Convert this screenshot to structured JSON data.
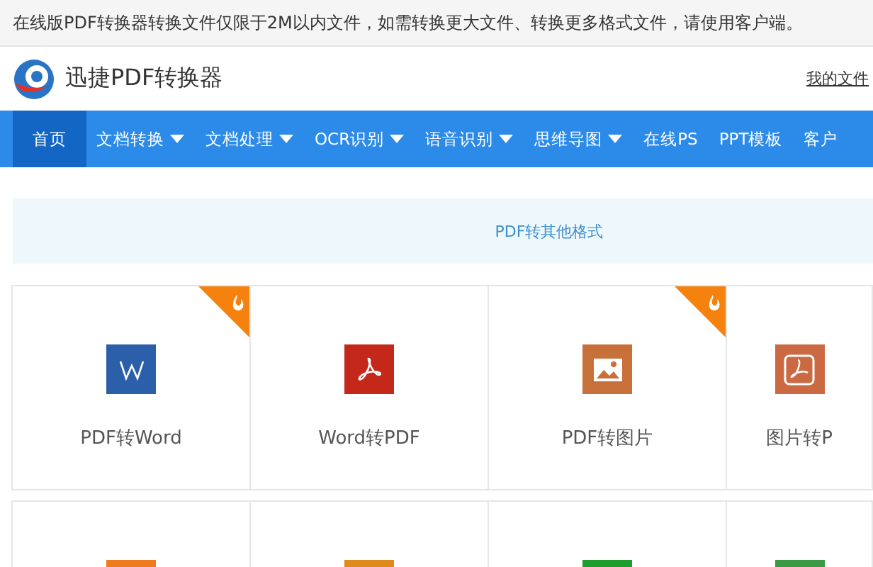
{
  "notice": "在线版PDF转换器转换文件仅限于2M以内文件，如需转换更大文件、转换更多格式文件，请使用客户端。",
  "header": {
    "title": "迅捷PDF转换器",
    "link": "我的文件"
  },
  "nav": [
    {
      "label": "首页",
      "selected": true,
      "dropdown": false
    },
    {
      "label": "文档转换",
      "selected": false,
      "dropdown": true
    },
    {
      "label": "文档处理",
      "selected": false,
      "dropdown": true
    },
    {
      "label": "OCR识别",
      "selected": false,
      "dropdown": true
    },
    {
      "label": "语音识别",
      "selected": false,
      "dropdown": true
    },
    {
      "label": "思维导图",
      "selected": false,
      "dropdown": true
    },
    {
      "label": "在线PS",
      "selected": false,
      "dropdown": false
    },
    {
      "label": "PPT模板",
      "selected": false,
      "dropdown": false
    },
    {
      "label": "客户",
      "selected": false,
      "dropdown": false
    }
  ],
  "section_title": "PDF转其他格式",
  "tools": [
    {
      "label": "PDF转Word",
      "kind": "word",
      "color": "#2b5fa9",
      "hot": true
    },
    {
      "label": "Word转PDF",
      "kind": "pdf",
      "color": "#c3281b",
      "hot": false
    },
    {
      "label": "PDF转图片",
      "kind": "image",
      "color": "#c8703a",
      "hot": true
    },
    {
      "label": "图片转P",
      "kind": "pdf-frame",
      "color": "#cb6a42",
      "hot": false
    }
  ],
  "tools_row_2": [
    {
      "color": "#f07a1e"
    },
    {
      "color": "#e08a1c"
    },
    {
      "color": "#1f9e2e"
    },
    {
      "color": "#3c9a45"
    }
  ]
}
